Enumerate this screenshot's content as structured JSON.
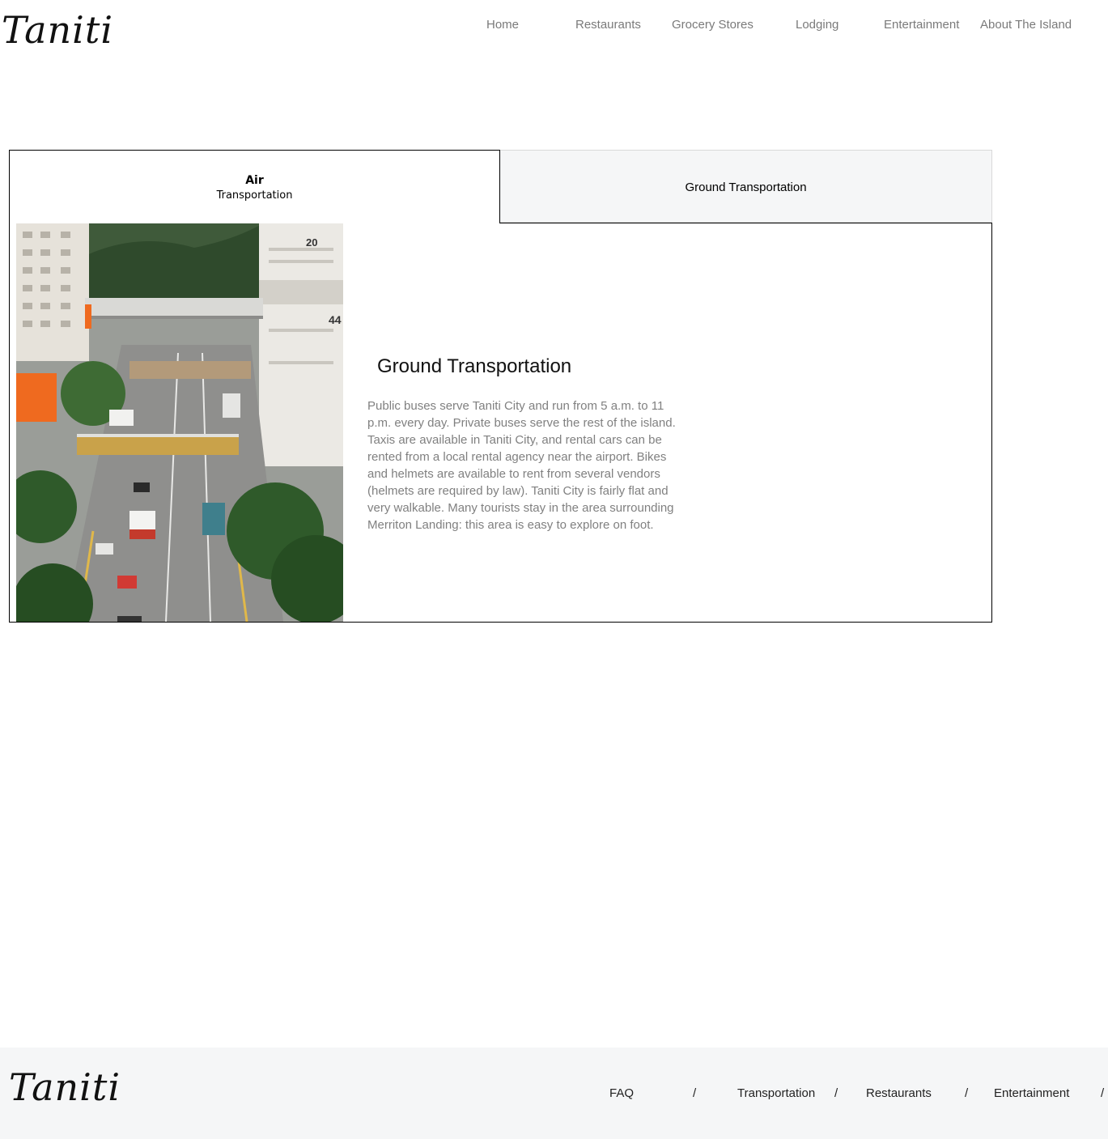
{
  "brand": {
    "name": "Taniti"
  },
  "nav": {
    "home": "Home",
    "restaurants": "Restaurants",
    "grocery": "Grocery Stores",
    "lodging": "Lodging",
    "entertainment": "Entertainment",
    "about": "About The Island"
  },
  "tabs": {
    "air_title": "Air",
    "air_sub": "Transportation",
    "ground": "Ground Transportation"
  },
  "content": {
    "title": "Ground Transportation",
    "body": "Public buses serve Taniti City and run from 5 a.m. to 11 p.m. every day. Private buses serve the rest of the island. Taxis are available in Taniti City, and rental cars can be rented from a local rental agency near the airport. Bikes and helmets are available to rent from several vendors (helmets are required by law). Taniti City is fairly flat and very walkable. Many tourists stay in the area surrounding Merriton Landing: this area is easy to explore on foot.",
    "photo_text_a": "20",
    "photo_text_b": "44"
  },
  "footer": {
    "faq": "FAQ",
    "transportation": "Transportation",
    "restaurants": "Restaurants",
    "entertainment": "Entertainment",
    "separator": "/"
  },
  "colors": {
    "nav_text": "#7a7a7a",
    "tab_inactive_bg": "#f5f6f7",
    "footer_bg": "#f5f6f7",
    "body_text": "#808080"
  }
}
